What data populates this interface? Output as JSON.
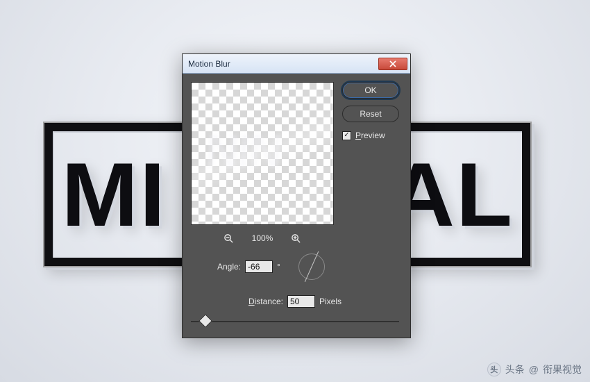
{
  "background": {
    "text_left": "MI",
    "text_right": "AL"
  },
  "dialog": {
    "title": "Motion Blur",
    "buttons": {
      "ok": "OK",
      "reset": "Reset"
    },
    "preview": {
      "label_prefix": "P",
      "label_rest": "review",
      "checked": true
    },
    "zoom_label": "100%",
    "angle": {
      "label": "Angle:",
      "value": "-66",
      "unit": "°"
    },
    "distance": {
      "label_prefix": "D",
      "label_rest": "istance:",
      "value": "50",
      "unit": "Pixels",
      "max": 1000
    },
    "ghost_preview": "NIN"
  },
  "watermark": {
    "prefix": "头条",
    "at": "@",
    "name": "衔果视觉"
  }
}
